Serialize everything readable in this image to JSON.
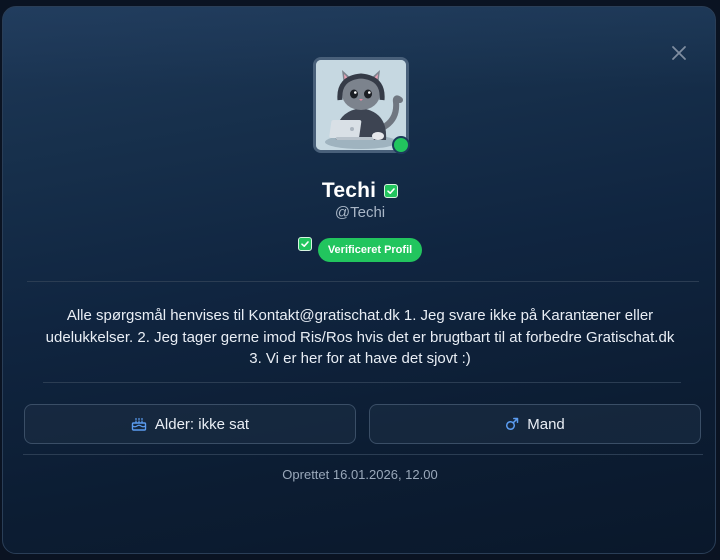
{
  "profile": {
    "name": "Techi",
    "handle": "@Techi",
    "verified_label": "Verificeret Profil",
    "bio": "Alle spørgsmål henvises til Kontakt@gratischat.dk 1. Jeg svare ikke på Karantæner eller udelukkelser. 2. Jeg tager gerne imod Ris/Ros hvis det er brugtbart til at forbedre Gratischat.dk 3. Vi er her for at have det sjovt :)",
    "online": true
  },
  "details": {
    "age_label": "Alder: ikke sat",
    "gender_label": "Mand"
  },
  "footer": {
    "created": "Oprettet 16.01.2026, 12.00"
  },
  "icons": {
    "close": "close-icon",
    "verified": "check-badge-icon",
    "age": "cake-icon",
    "gender": "male-symbol-icon"
  },
  "colors": {
    "accent_green": "#22c55e",
    "icon_blue": "#5b9cf0"
  }
}
